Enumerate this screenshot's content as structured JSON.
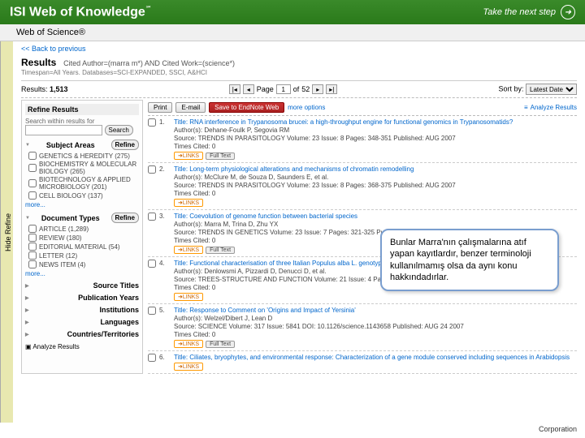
{
  "header": {
    "brand": "ISI Web of Knowledge",
    "tagline": "Take the next step"
  },
  "subheader": "Web of Science®",
  "back_link": "<< Back to previous",
  "results": {
    "label": "Results",
    "query": "Cited Author=(marra m*) AND Cited Work=(science*)",
    "subline": "Timespan=All Years. Databases=SCI-EXPANDED, SSCI, A&HCI",
    "count_label": "Results:",
    "count": "1,513"
  },
  "pager": {
    "label": "Page",
    "value": "1",
    "of_label": "of",
    "total": "52"
  },
  "sort": {
    "label": "Sort by:",
    "value": "Latest Date"
  },
  "hide_tab": "Hide Refine",
  "sidebar": {
    "title": "Refine Results",
    "search_placeholder": "Search within results for",
    "search_btn": "Search",
    "refine_btn": "Refine",
    "subject_head": "Subject Areas",
    "subjects": [
      "GENETICS & HEREDITY (275)",
      "BIOCHEMISTRY & MOLECULAR BIOLOGY (265)",
      "BIOTECHNOLOGY & APPLIED MICROBIOLOGY (201)",
      "CELL BIOLOGY (137)"
    ],
    "more": "more...",
    "doctype_head": "Document Types",
    "doctypes": [
      "ARTICLE (1,289)",
      "REVIEW (180)",
      "EDITORIAL MATERIAL (54)",
      "LETTER (12)",
      "NEWS ITEM (4)"
    ],
    "other_facets": [
      "Source Titles",
      "Publication Years",
      "Institutions",
      "Languages",
      "Countries/Territories"
    ],
    "analyze_link": "Analyze Results"
  },
  "actions": {
    "print": "Print",
    "email": "E-mail",
    "save": "Save to EndNote Web",
    "more": "more options",
    "analyze": "Analyze Results"
  },
  "records": [
    {
      "n": "1.",
      "title": "Title: RNA interference in Trypanosoma brucei: a high-throughput engine for functional genomics in Trypanosomatids?",
      "authors": "Author(s): Dehane-Foulk P, Segovia RM",
      "source": "Source: TRENDS IN PARASITOLOGY  Volume: 23  Issue: 8  Pages: 348-351  Published: AUG 2007",
      "times": "Times Cited: 0",
      "ft": true
    },
    {
      "n": "2.",
      "title": "Title: Long-term physiological alterations and mechanisms of chromatin remodelling",
      "authors": "Author(s): McClure M, de Souza D, Saunders E, et al.",
      "source": "Source: TRENDS IN PARASITOLOGY  Volume: 23  Issue: 8  Pages: 368-375  Published: AUG 2007",
      "times": "Times Cited: 0",
      "ft": false
    },
    {
      "n": "3.",
      "title": "Title: Coevolution of genome function between bacterial species",
      "authors": "Author(s): Marra M, Trina D, Zhu YX",
      "source": "Source: TRENDS IN GENETICS  Volume: 23  Issue: 7  Pages: 321-325  Published: JUL 2007",
      "times": "Times Cited: 0",
      "ft": true
    },
    {
      "n": "4.",
      "title": "Title: Functional characterisation of three Italian Populus alba L. genotypes under salinity stress",
      "authors": "Author(s): Denlowsmi A, Pizzardi D, Denucci D, et al.",
      "source": "Source: TREES-STRUCTURE AND FUNCTION  Volume: 21  Issue: 4  Pages: 465-477  Published: JUL 2007",
      "times": "Times Cited: 0",
      "ft": false
    },
    {
      "n": "5.",
      "title": "Title: Response to Comment on 'Origins and Impact of Yersinia'",
      "authors": "Author(s): Welzel/Dibert J, Lean D",
      "source": "Source: SCIENCE  Volume: 317  Issue: 5841  DOI: 10.1126/science.1143658  Published: AUG 24 2007",
      "times": "Times Cited: 0",
      "ft": true
    },
    {
      "n": "6.",
      "title": "Title: Ciliates, bryophytes, and environmental response: Characterization of a gene module conserved including sequences in Arabidopsis",
      "authors": "",
      "source": "",
      "times": "",
      "ft": false
    }
  ],
  "callout": "Bunlar Marra'nın çalışmalarına atıf yapan kayıtlardır, benzer terminoloji kullanılmamış olsa da aynı konu hakkındadırlar.",
  "footer": "Corporation"
}
